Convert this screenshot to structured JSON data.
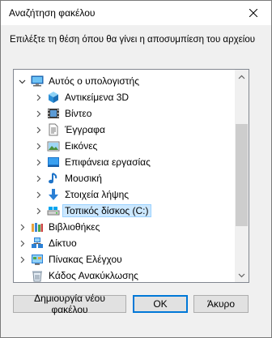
{
  "window": {
    "title": "Αναζήτηση φακέλου"
  },
  "instruction": "Επιλέξτε τη θέση όπου θα γίνει η αποσυμπίεση του αρχείου",
  "tree": {
    "items": [
      {
        "label": "Αυτός ο υπολογιστής",
        "icon": "computer-icon",
        "expanded": true
      },
      {
        "label": "Αντικείμενα 3D",
        "icon": "objects-3d-icon"
      },
      {
        "label": "Βίντεο",
        "icon": "videos-icon"
      },
      {
        "label": "Έγγραφα",
        "icon": "documents-icon"
      },
      {
        "label": "Εικόνες",
        "icon": "pictures-icon"
      },
      {
        "label": "Επιφάνεια εργασίας",
        "icon": "desktop-icon"
      },
      {
        "label": "Μουσική",
        "icon": "music-icon"
      },
      {
        "label": "Στοιχεία λήψης",
        "icon": "downloads-icon"
      },
      {
        "label": "Τοπικός δίσκος (C:)",
        "icon": "local-disk-icon",
        "selected": true
      },
      {
        "label": "Βιβλιοθήκες",
        "icon": "libraries-icon"
      },
      {
        "label": "Δίκτυο",
        "icon": "network-icon"
      },
      {
        "label": "Πίνακας Ελέγχου",
        "icon": "control-panel-icon"
      },
      {
        "label": "Κάδος Ανακύκλωσης",
        "icon": "recycle-bin-icon"
      }
    ]
  },
  "buttons": {
    "new_folder": "Δημιουργία νέου φακέλου",
    "ok": "OK",
    "cancel": "Άκυρο"
  },
  "colors": {
    "selection": "#cce8ff",
    "accent": "#0078d7"
  }
}
